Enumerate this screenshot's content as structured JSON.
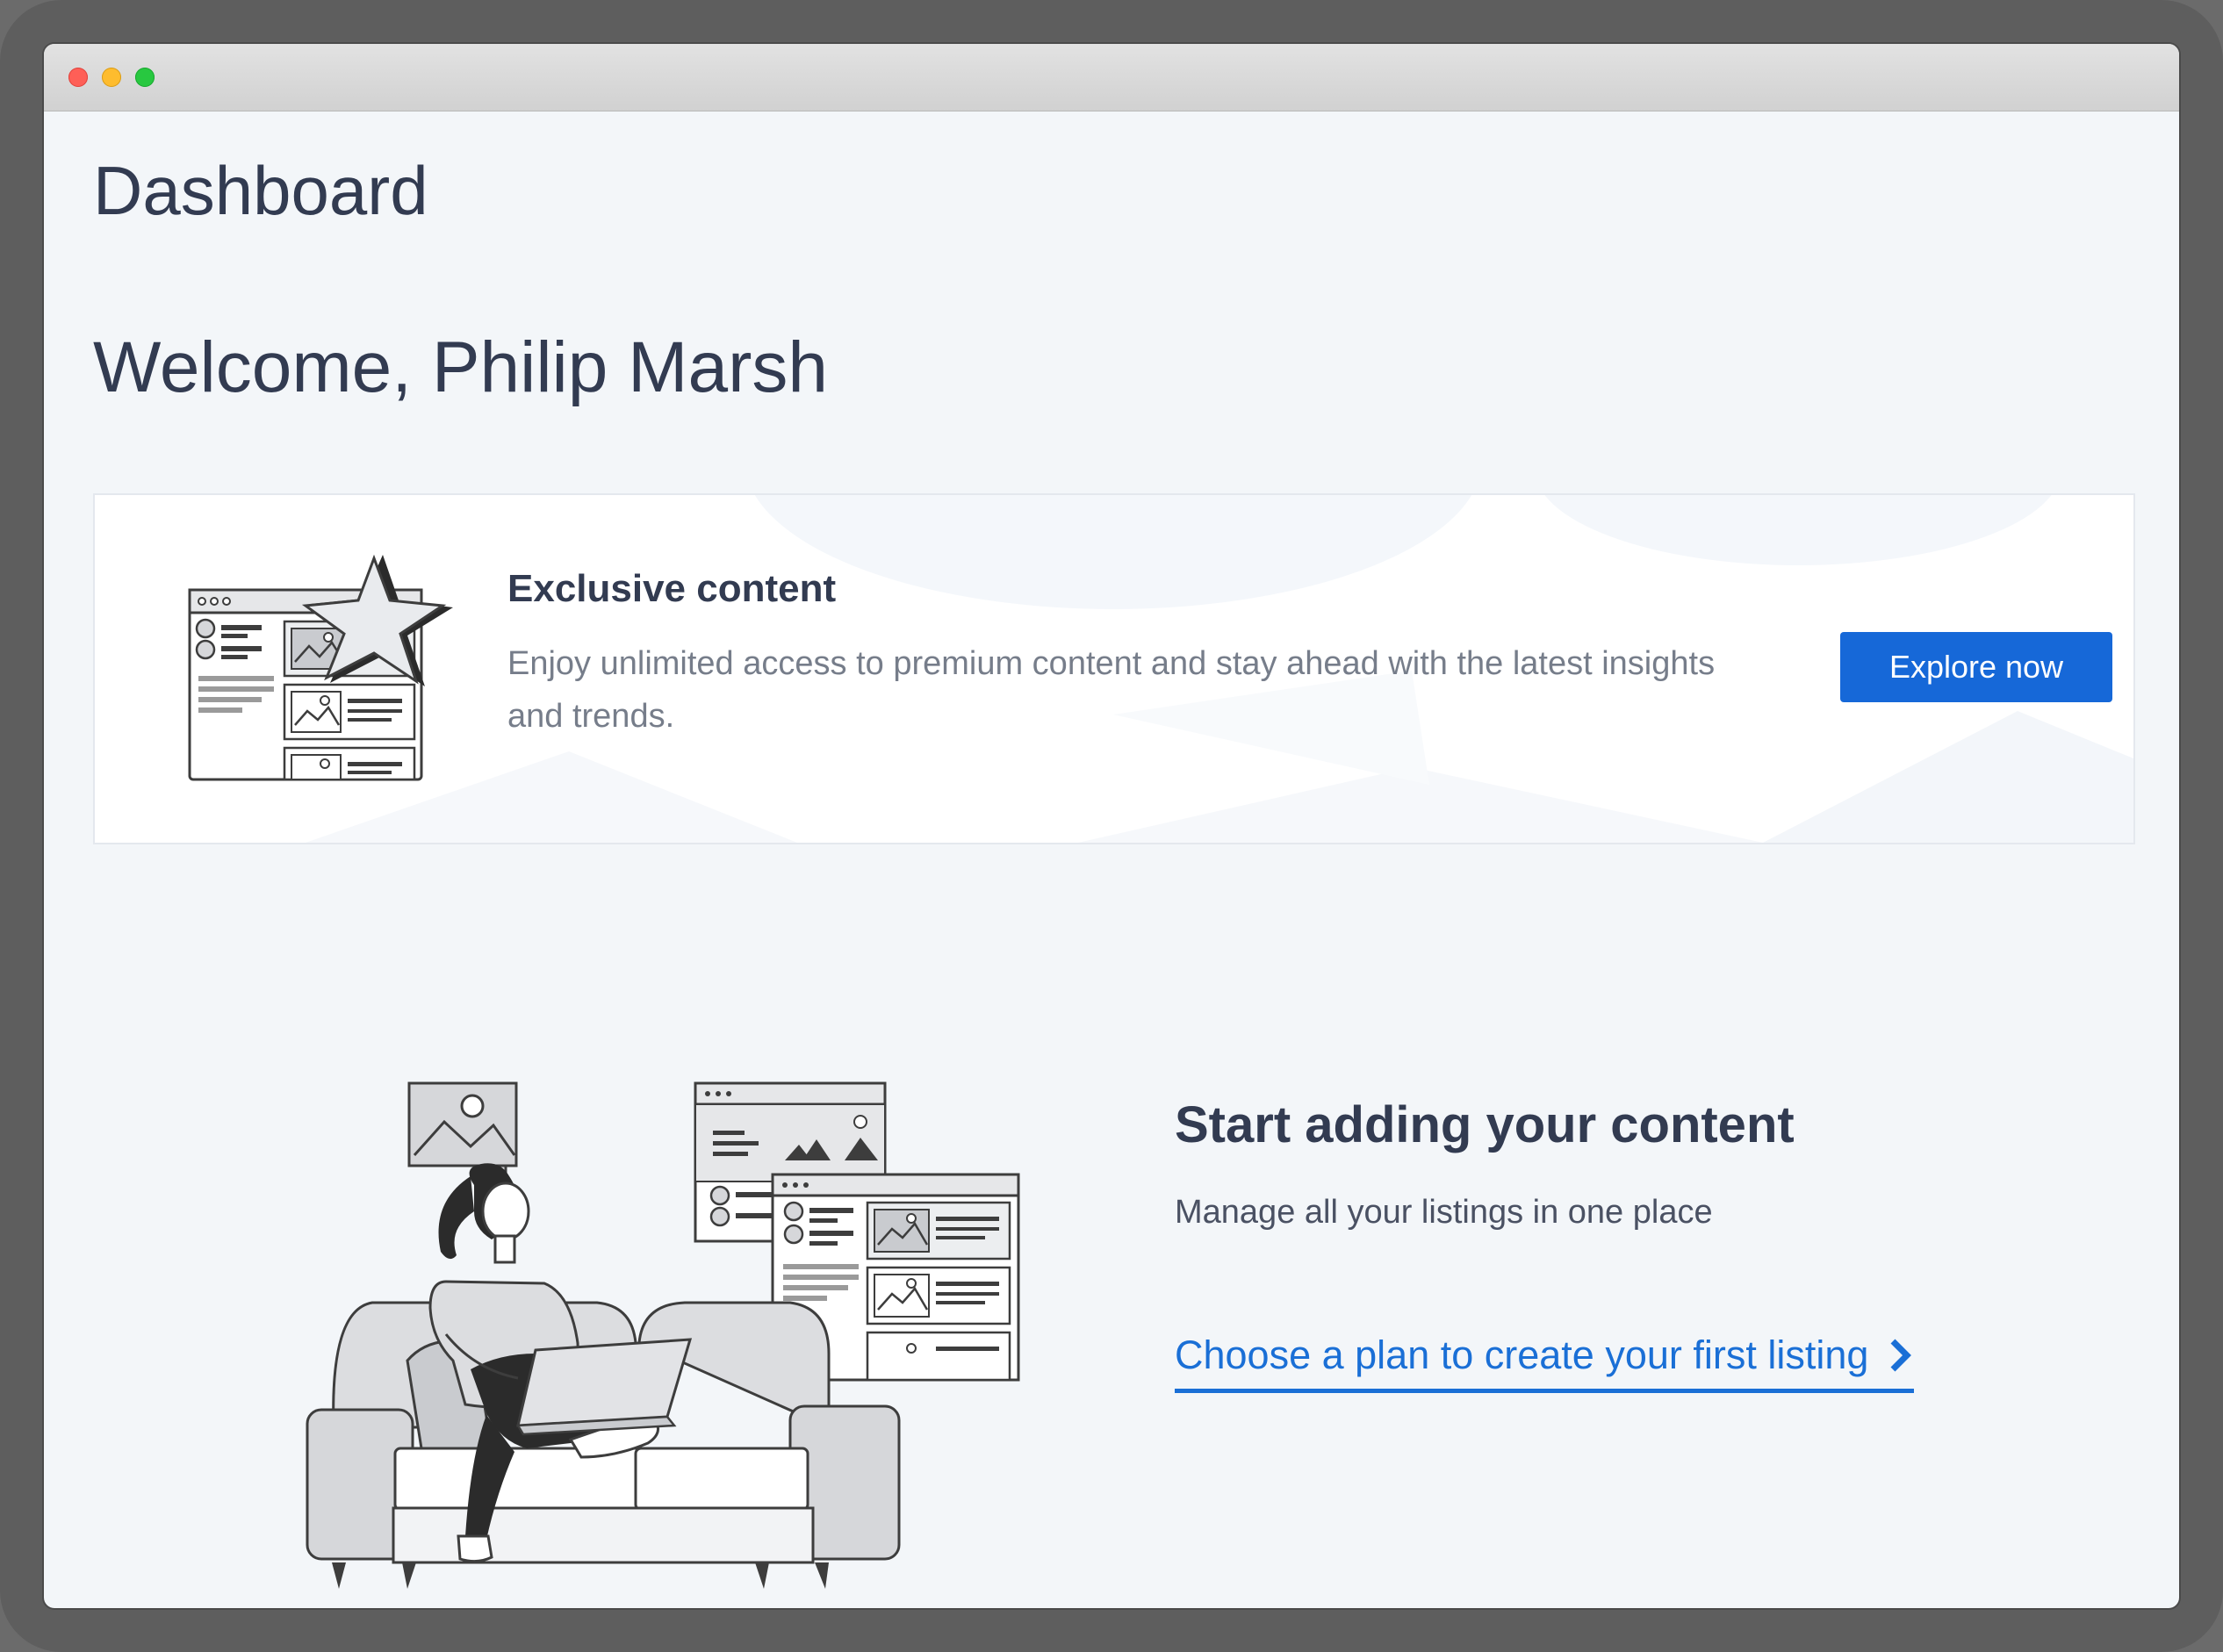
{
  "window": {
    "controls": [
      "close",
      "minimize",
      "zoom"
    ]
  },
  "page": {
    "title": "Dashboard",
    "welcome": "Welcome, Philip Marsh"
  },
  "promo": {
    "heading": "Exclusive content",
    "description": "Enjoy unlimited access to premium content and stay ahead with the latest insights and trends.",
    "button_label": "Explore now",
    "illustration": "star-browser-illustration"
  },
  "empty_state": {
    "heading": "Start adding your content",
    "subtext": "Manage all your listings in one place",
    "link_label": "Choose a plan to create your first listing",
    "link_icon": "chevron-right-icon",
    "illustration": "woman-on-sofa-laptop-illustration"
  },
  "colors": {
    "text_dark": "#323b51",
    "text_muted": "#767d8a",
    "accent": "#1668d8",
    "background": "#f3f6f9"
  }
}
